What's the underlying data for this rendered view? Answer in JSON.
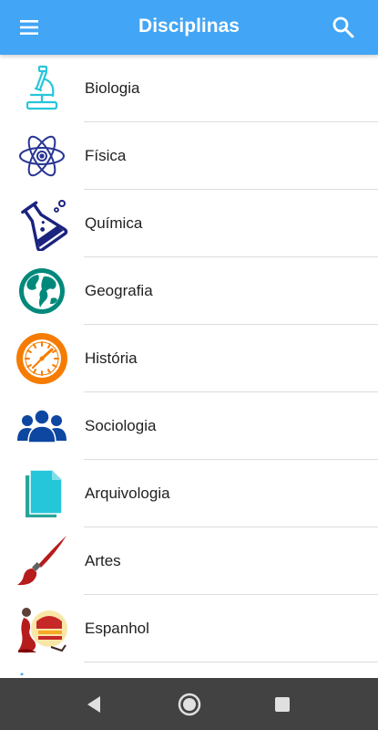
{
  "appbar": {
    "title": "Disciplinas",
    "menu_icon": "menu-icon",
    "search_icon": "search-icon",
    "background": "#42a5f5"
  },
  "subjects": [
    {
      "label": "Biologia",
      "icon": "microscope-icon"
    },
    {
      "label": "Física",
      "icon": "atom-icon"
    },
    {
      "label": "Química",
      "icon": "flask-icon"
    },
    {
      "label": "Geografia",
      "icon": "globe-icon"
    },
    {
      "label": "História",
      "icon": "clock-icon"
    },
    {
      "label": "Sociologia",
      "icon": "people-icon"
    },
    {
      "label": "Arquivologia",
      "icon": "documents-icon"
    },
    {
      "label": "Artes",
      "icon": "paintbrush-icon"
    },
    {
      "label": "Espanhol",
      "icon": "flamenco-icon"
    }
  ],
  "navbar": {
    "back_icon": "back-icon",
    "home_icon": "home-icon",
    "recents_icon": "recents-icon"
  }
}
